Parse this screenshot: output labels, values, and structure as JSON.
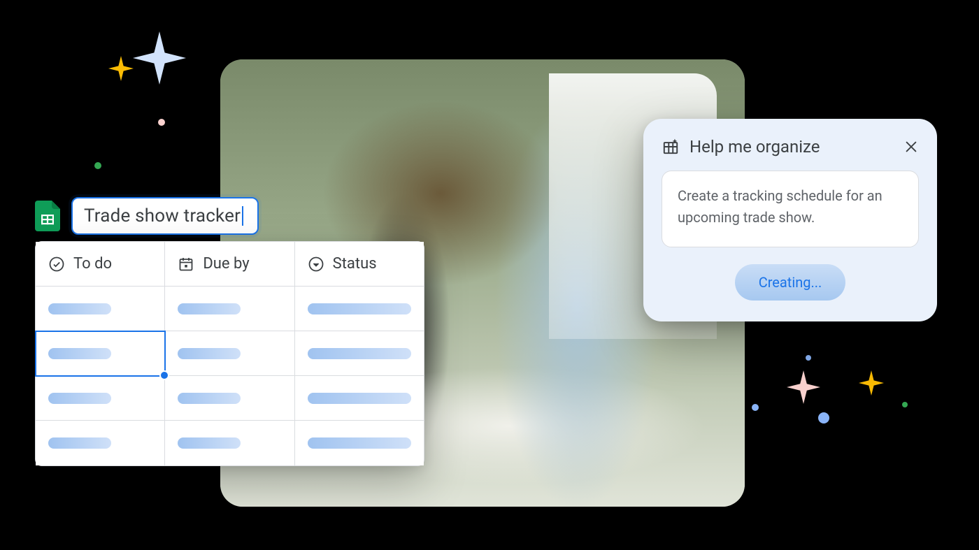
{
  "sheet": {
    "title": "Trade show tracker",
    "columns": [
      {
        "label": "To do",
        "icon": "check-circle"
      },
      {
        "label": "Due by",
        "icon": "calendar"
      },
      {
        "label": "Status",
        "icon": "dropdown"
      }
    ],
    "rowCount": 4,
    "selected": {
      "row": 1,
      "col": 0
    }
  },
  "hmo": {
    "title": "Help me organize",
    "prompt": "Create a tracking schedule for an upcoming trade show.",
    "button": "Creating..."
  }
}
